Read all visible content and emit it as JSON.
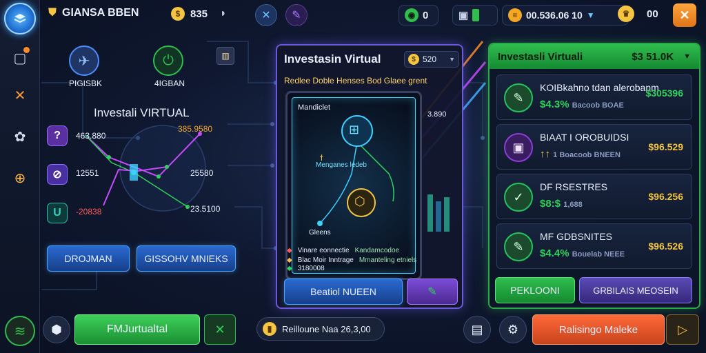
{
  "colors": {
    "green": "#2fbd4e",
    "blue": "#2a6ad1",
    "purple": "#6b5bd6",
    "orange": "#e5582b",
    "gold": "#f5c542"
  },
  "top": {
    "brand": "GIANSA BBEN",
    "brand_icon": "shield-icon",
    "stat1": "835",
    "gems": "0",
    "balance": "00.536.06 10",
    "tokens": "00"
  },
  "left": {
    "node1_label": "PIGISBK",
    "node2_label": "4IGBAN",
    "title": "Investali VIRTUAL",
    "row1_left": "463.880",
    "row1_right": "385.9580",
    "row2_left": "12551",
    "row2_right": "25580",
    "row3_left": "-20838",
    "row3_right": "23.5100",
    "btn1": "DROJMAN",
    "btn2": "GISSOHV MNIEKS"
  },
  "center": {
    "title": "Investasin Virtual",
    "price": "520",
    "subtitle": "Redlee Doble Henses Bod Glaee grent",
    "screen_label": "Mandiclet",
    "node_center": "Menganes ledeb",
    "node_bottom": "Gleens",
    "side_val": "3.890",
    "tag1": "Vinare eonnectie",
    "tag1_val": "Kandamcodoe",
    "tag2": "Blac Moir Inntrage",
    "tag2_val": "Mmanteling etniels",
    "tag3": "3180008",
    "action_btn": "Beatiol NUEEN"
  },
  "right": {
    "header": "Investasli Virtuali",
    "header_value": "$3 51.0K",
    "cards": [
      {
        "title": "KOIBkahno tdan alerobanm",
        "sub": "$4.3%",
        "sub2": "Bacoob BOAE",
        "value": "$305396",
        "value_color": "#2fd25a",
        "icon_color": "#22c55e",
        "icon": "✎"
      },
      {
        "title": "BIAAT I OROBUIDSI",
        "sub": "↑↑",
        "sub2": "1 Boacoob BNEEN",
        "value": "$96.529",
        "value_color": "#f5d142",
        "icon_color": "#8b3fd9",
        "icon": "▣"
      },
      {
        "title": "DF RSESTRES",
        "sub": "$8:$",
        "sub2": "1,688",
        "value": "$96.256",
        "value_color": "#f5d142",
        "icon_color": "#22c55e",
        "icon": "✓"
      },
      {
        "title": "MF GDBSNITES",
        "sub": "$4.4%",
        "sub2": "Bouelab NEEE",
        "value": "$96.526",
        "value_color": "#f5d142",
        "icon_color": "#22c55e",
        "icon": "✎"
      }
    ],
    "btn1": "PEKLOONI",
    "btn2": "GRBILAIS MEOSEIN"
  },
  "bottom": {
    "main_btn": "FMJurtualtal",
    "resource": "Reilloune Naa 26,3,00",
    "orange_btn": "Ralisingo Maleke"
  }
}
